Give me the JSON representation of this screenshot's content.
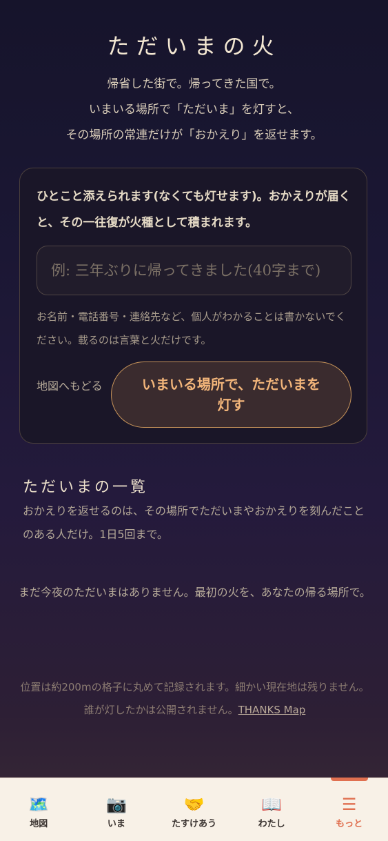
{
  "header": {
    "title": "ただいまの火",
    "intro_lines": [
      "帰省した街で。帰ってきた国で。",
      "いまいる場所で「ただいま」を灯すと、",
      "その場所の常連だけが「おかえり」を返せます。"
    ]
  },
  "form": {
    "description": "ひとこと添えられます(なくても灯せます)。おかえりが届くと、その一往復が火種として積まれます。",
    "message_placeholder": "例: 三年ぶりに帰ってきました(40字まで)",
    "message_value": "",
    "privacy_notice": "お名前・電話番号・連絡先など、個人がわかることは書かないでください。載るのは言葉と火だけです。",
    "back_label": "地図へもどる",
    "submit_label": "いまいる場所で、ただいまを灯す"
  },
  "list": {
    "title": "ただいまの一覧",
    "description": "おかえりを返せるのは、その場所でただいまやおかえりを刻んだことのある人だけ。1日5回まで。",
    "empty_message": "まだ今夜のただいまはありません。最初の火を、あなたの帰る場所で。"
  },
  "footer": {
    "location_note": "位置は約200mの格子に丸めて記録されます。細かい現在地は残りません。",
    "anonymity_note": "誰が灯したかは公開されません。",
    "link_label": "THANKS Map"
  },
  "tabs": [
    {
      "label": "地図",
      "icon": "world-map-icon",
      "glyph": "🗺️"
    },
    {
      "label": "いま",
      "icon": "camera-icon",
      "glyph": "📷"
    },
    {
      "label": "たすけあう",
      "icon": "handshake-icon",
      "glyph": "🤝"
    },
    {
      "label": "わたし",
      "icon": "open-book-icon",
      "glyph": "📖"
    },
    {
      "label": "もっと",
      "icon": "menu-icon",
      "glyph": "☰",
      "active": true
    }
  ],
  "colors": {
    "accent": "#e07050",
    "cta_text": "#f2b57a",
    "cta_border": "#c9955a"
  }
}
